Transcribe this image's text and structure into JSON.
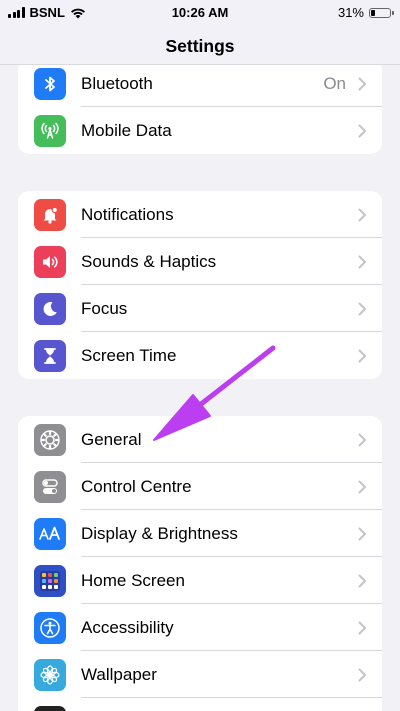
{
  "status_bar": {
    "carrier": "BSNL",
    "time": "10:26 AM",
    "battery": "31%",
    "battery_level": 0.31
  },
  "nav": {
    "title": "Settings"
  },
  "groups": [
    {
      "items": [
        {
          "label": "Bluetooth",
          "value": "On",
          "icon": "bluetooth-icon",
          "color": "#1f7bf6"
        },
        {
          "label": "Mobile Data",
          "icon": "antenna-icon",
          "color": "#45bd5b"
        }
      ]
    },
    {
      "items": [
        {
          "label": "Notifications",
          "icon": "bell-icon",
          "color": "#ee4c45"
        },
        {
          "label": "Sounds & Haptics",
          "icon": "speaker-icon",
          "color": "#ec3f59"
        },
        {
          "label": "Focus",
          "icon": "moon-icon",
          "color": "#5756ce"
        },
        {
          "label": "Screen Time",
          "icon": "hourglass-icon",
          "color": "#5756ce"
        }
      ]
    },
    {
      "items": [
        {
          "label": "General",
          "icon": "gear-icon",
          "color": "#8e8e93"
        },
        {
          "label": "Control Centre",
          "icon": "toggles-icon",
          "color": "#8e8e93"
        },
        {
          "label": "Display & Brightness",
          "icon": "text-size-icon",
          "color": "#1f7bf6"
        },
        {
          "label": "Home Screen",
          "icon": "app-grid-icon",
          "color": "#2f4fc4"
        },
        {
          "label": "Accessibility",
          "icon": "accessibility-icon",
          "color": "#1f7bf6"
        },
        {
          "label": "Wallpaper",
          "icon": "flower-icon",
          "color": "#36aadc"
        }
      ]
    }
  ],
  "annotation": {
    "color": "#bb3ff0",
    "points_to": "General"
  }
}
